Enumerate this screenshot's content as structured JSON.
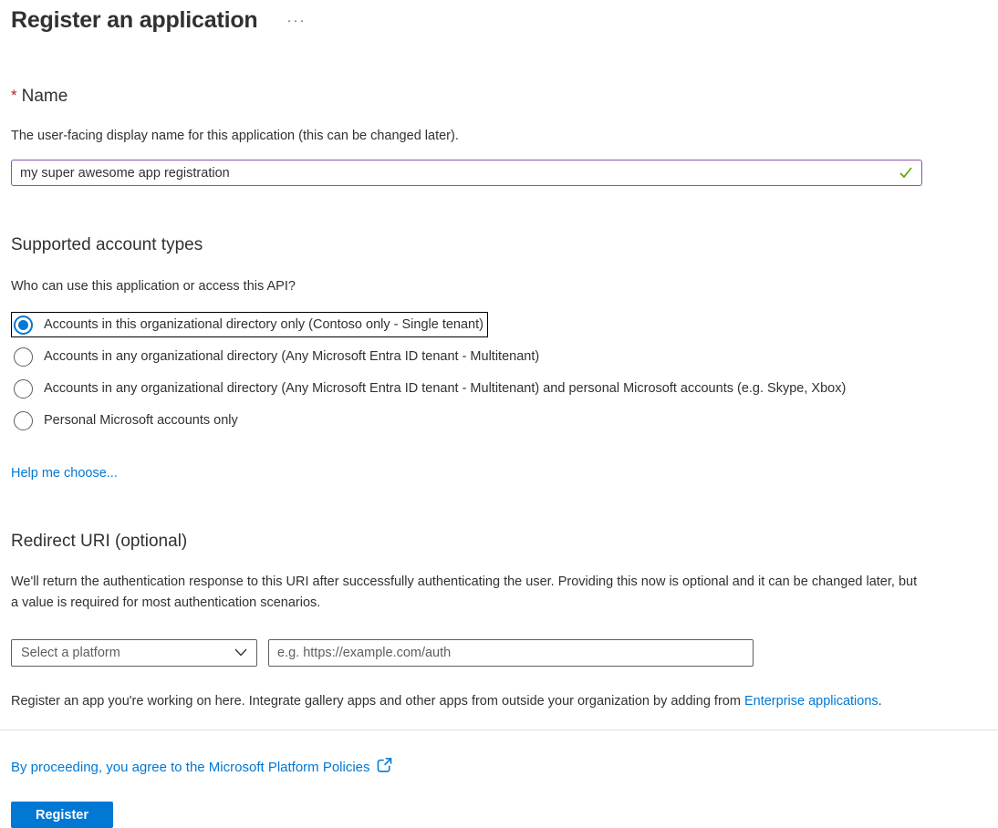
{
  "page": {
    "title": "Register an application",
    "more_menu": "···"
  },
  "name_section": {
    "required_marker": "*",
    "label": "Name",
    "description": "The user-facing display name for this application (this can be changed later).",
    "value": "my super awesome app registration",
    "valid_icon": "checkmark-icon"
  },
  "account_types": {
    "heading": "Supported account types",
    "question": "Who can use this application or access this API?",
    "options": [
      {
        "label": "Accounts in this organizational directory only (Contoso only - Single tenant)",
        "selected": true
      },
      {
        "label": "Accounts in any organizational directory (Any Microsoft Entra ID tenant - Multitenant)",
        "selected": false
      },
      {
        "label": "Accounts in any organizational directory (Any Microsoft Entra ID tenant - Multitenant) and personal Microsoft accounts (e.g. Skype, Xbox)",
        "selected": false
      },
      {
        "label": "Personal Microsoft accounts only",
        "selected": false
      }
    ],
    "help_link": "Help me choose..."
  },
  "redirect_section": {
    "heading": "Redirect URI (optional)",
    "description": "We'll return the authentication response to this URI after successfully authenticating the user. Providing this now is optional and it can be changed later, but a value is required for most authentication scenarios.",
    "platform_select_placeholder": "Select a platform",
    "uri_placeholder": "e.g. https://example.com/auth",
    "note_prefix": "Register an app you're working on here. Integrate gallery apps and other apps from outside your organization by adding from ",
    "note_link": "Enterprise applications",
    "note_suffix": "."
  },
  "footer": {
    "policy_link": "By proceeding, you agree to the Microsoft Platform Policies",
    "register_button": "Register"
  },
  "colors": {
    "accent_blue": "#0078d4",
    "name_input_border": "#8c50aa",
    "valid_green": "#57a300",
    "required_red": "#a4262c",
    "text": "#323130",
    "muted": "#605e5c",
    "divider": "#e1dfdd"
  }
}
